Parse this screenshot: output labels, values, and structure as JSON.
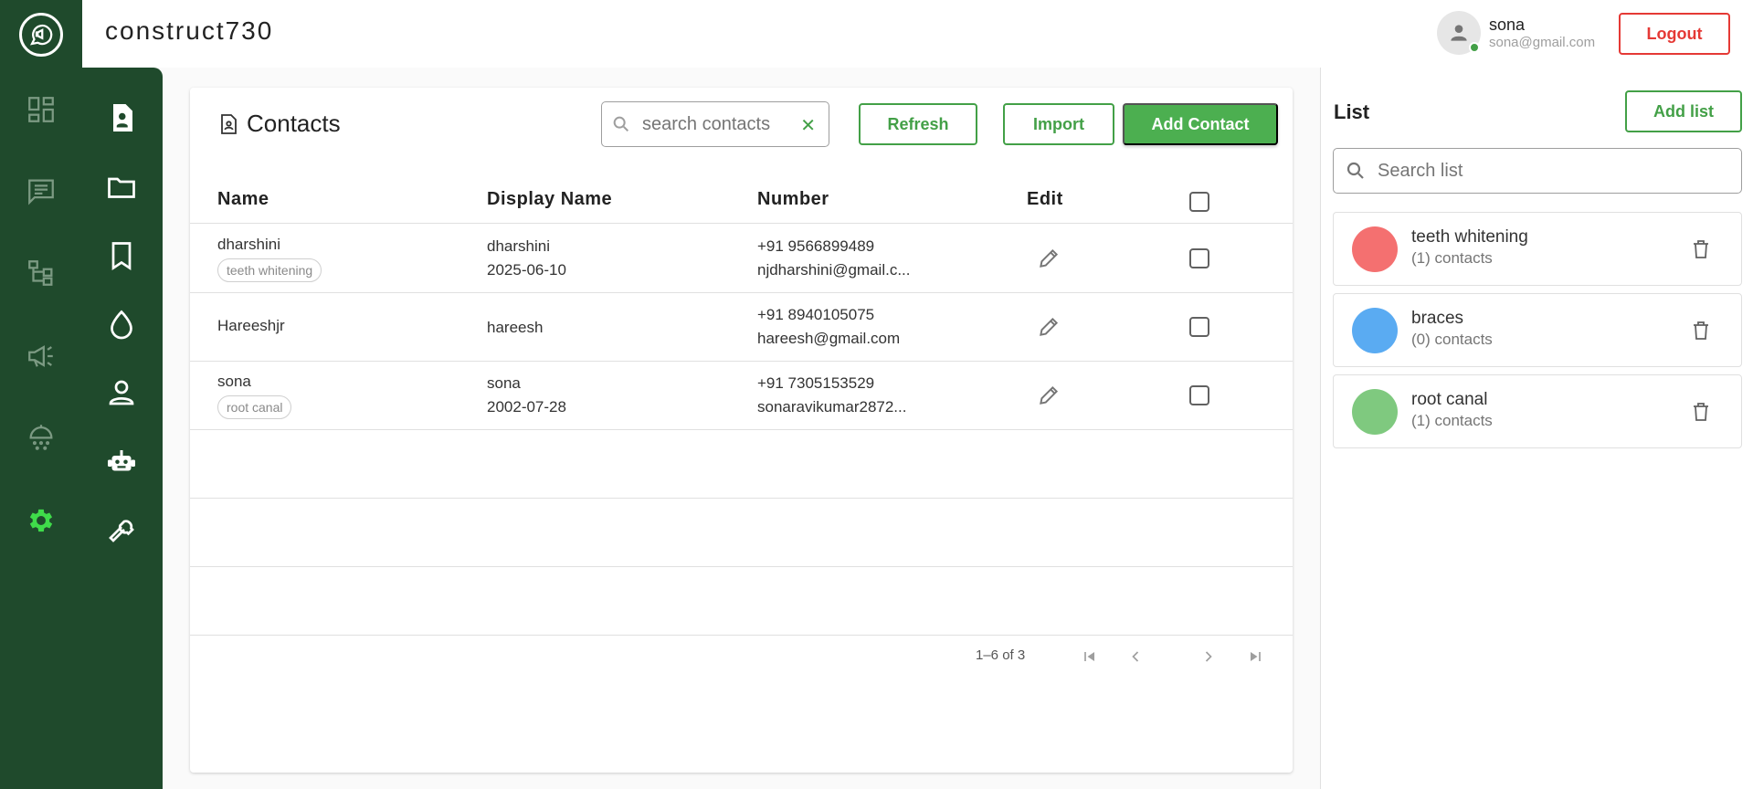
{
  "header": {
    "app_title": "construct730",
    "user_name": "sona",
    "user_email": "sona@gmail.com",
    "logout_label": "Logout"
  },
  "rail": {
    "items": [
      "dashboard-icon",
      "chat-icon",
      "flow-icon",
      "campaign-icon",
      "broadcast-icon",
      "settings-icon"
    ],
    "active": "settings-icon"
  },
  "subrail": {
    "items": [
      "contacts-icon",
      "folder-icon",
      "bookmark-icon",
      "drop-icon",
      "person-icon",
      "bot-icon",
      "wrench-icon"
    ],
    "active": "contacts-icon"
  },
  "contacts": {
    "title": "Contacts",
    "search_placeholder": "search contacts",
    "refresh_label": "Refresh",
    "import_label": "Import",
    "add_label": "Add Contact",
    "columns": {
      "name": "Name",
      "display_name": "Display Name",
      "number": "Number",
      "edit": "Edit"
    },
    "rows": [
      {
        "name": "dharshini",
        "tag": "teeth whitening",
        "display_name": "dharshini",
        "date": "2025-06-10",
        "number": "+91 9566899489",
        "email": "njdharshini@gmail.c..."
      },
      {
        "name": "Hareeshjr",
        "tag": "",
        "display_name": "hareesh",
        "date": "",
        "number": "+91 8940105075",
        "email": "hareesh@gmail.com"
      },
      {
        "name": "sona",
        "tag": "root canal",
        "display_name": "sona",
        "date": "2002-07-28",
        "number": "+91 7305153529",
        "email": "sonaravikumar2872..."
      }
    ],
    "pagination": "1–6 of 3"
  },
  "lists": {
    "title": "List",
    "add_label": "Add list",
    "search_placeholder": "Search list",
    "items": [
      {
        "name": "teeth whitening",
        "count": "(1) contacts",
        "color": "#f47070"
      },
      {
        "name": "braces",
        "count": "(0) contacts",
        "color": "#5aabf2"
      },
      {
        "name": "root canal",
        "count": "(1) contacts",
        "color": "#7fc97f"
      }
    ]
  },
  "colors": {
    "sidebar": "#1f4a2c",
    "accent": "#4caf50",
    "logout": "#e53935",
    "active_icon": "#3fdc4a"
  }
}
